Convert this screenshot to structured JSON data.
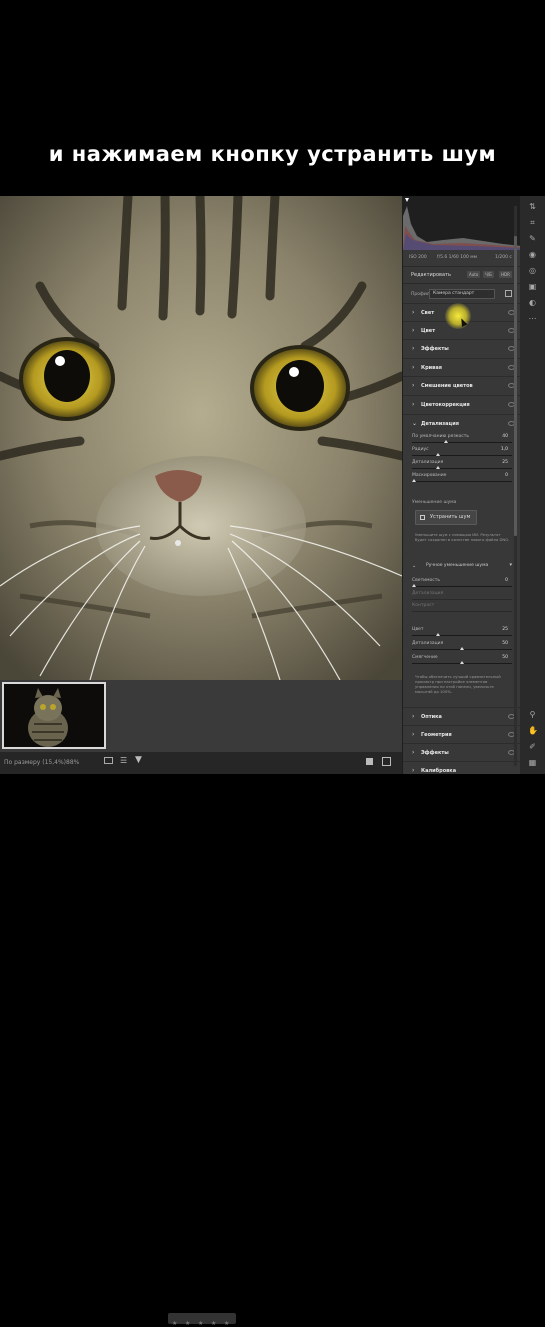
{
  "caption": "и нажимаем кнопку устранить шум",
  "colors": {
    "panel_bg": "#383838",
    "canvas_bg": "#2b2b2b",
    "accent_highlight": "#f5e13a"
  },
  "histogram": {
    "info_left": "ISO 200",
    "info_mid": "f/5.6 1/60 100 мм",
    "info_right": "1/200 с"
  },
  "panel": {
    "title": "Редактировать",
    "tab_buttons": [
      "Auto",
      "Ч/Б",
      "HDR"
    ],
    "profile_label": "Профиль",
    "profile_value": "Камера стандарт",
    "sections_top": [
      "Свет",
      "Цвет",
      "Эффекты",
      "Кривая",
      "Смешение цветов",
      "Цветокоррекция",
      "Детализация"
    ],
    "detail_rows": [
      {
        "label": "По умолчанию резкость",
        "value": "40"
      },
      {
        "label": "Радиус",
        "value": "1,0"
      },
      {
        "label": "Детализация",
        "value": "25"
      },
      {
        "label": "Маскирование",
        "value": "0"
      }
    ],
    "nr_title": "Уменьшение шума",
    "nr_button": "Устранить шум",
    "nr_note": "Уменьшите шум с помощью ИИ. Результат будет сохранен в качестве нового файла DNG.",
    "manual_label": "Ручное уменьшение шума",
    "manual_rows": [
      {
        "label": "Светимость",
        "value": "0"
      },
      {
        "label": "Детализация",
        "value": ""
      },
      {
        "label": "Контраст",
        "value": ""
      }
    ],
    "color_rows": [
      {
        "label": "Цвет",
        "value": "25"
      },
      {
        "label": "Детализация",
        "value": "50"
      },
      {
        "label": "Смягчение",
        "value": "50"
      }
    ],
    "bottom_note": "Чтобы обеспечить лучший сравнительный просмотр при настройке элементов управления по этой панели, увеличьте масштаб до 100%.",
    "sections_bottom": [
      "Оптика",
      "Геометрия",
      "Эффекты",
      "Калибровка"
    ]
  },
  "status": {
    "fit_label": "По размеру (15,4%)",
    "zoom": "88%"
  }
}
